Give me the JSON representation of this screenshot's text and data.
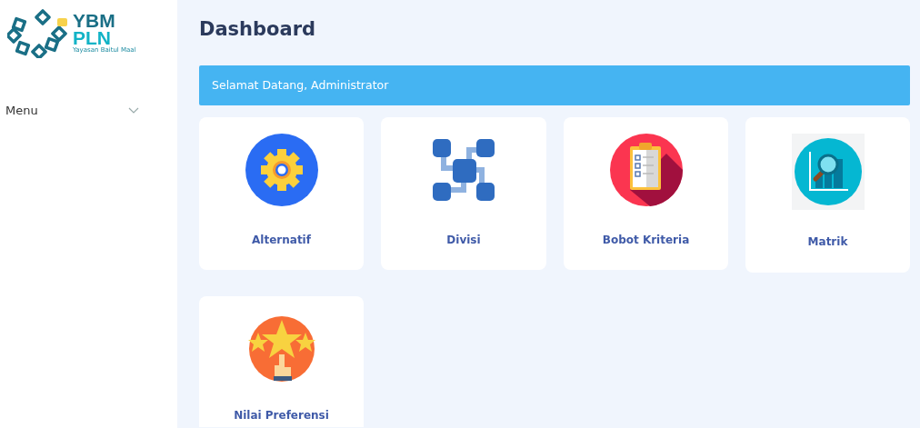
{
  "logo": {
    "line_1": "YBM",
    "line_2": "PLN",
    "tagline": "Yayasan Baitul Maal"
  },
  "sidebar": {
    "items": [
      {
        "label": "Menu",
        "expanded": false
      }
    ]
  },
  "page_title": "Dashboard",
  "welcome_banner": "Selamat Datang, Administrator",
  "cards": [
    {
      "kind": "gear",
      "label": "Alternatif"
    },
    {
      "kind": "network",
      "label": "Divisi"
    },
    {
      "kind": "clipboard",
      "label": "Bobot Kriteria"
    },
    {
      "kind": "chart",
      "label": "Matrik"
    },
    {
      "kind": "stars",
      "label": "Nilai Preferensi"
    }
  ]
}
